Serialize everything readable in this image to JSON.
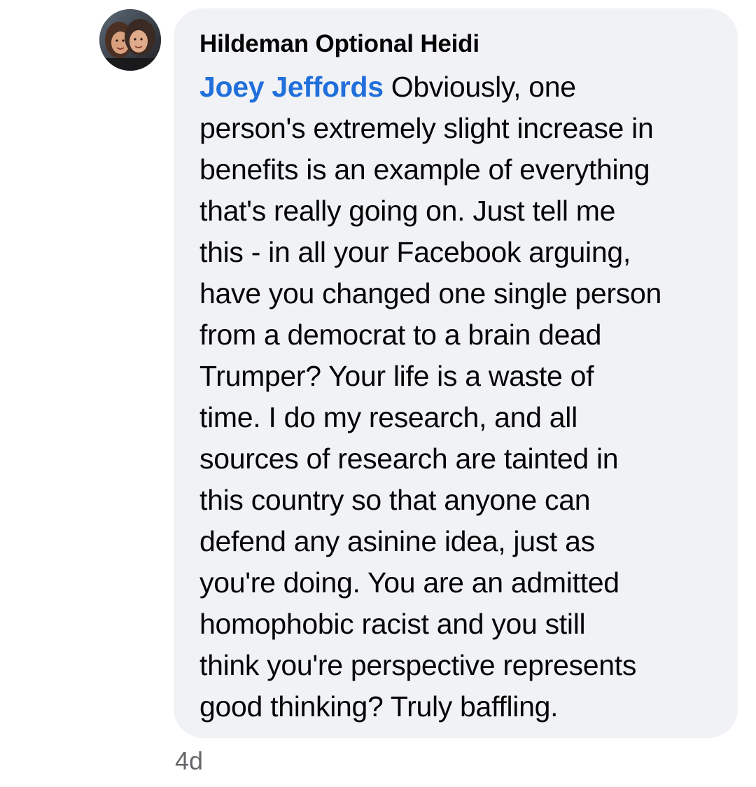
{
  "comment": {
    "author": "Hildeman Optional Heidi",
    "mention": "Joey Jeffords",
    "lines": [
      " Obviously, one",
      "person's extremely slight increase in",
      "benefits is an example of everything",
      "that's really going on. Just tell me",
      "this - in all your Facebook arguing,",
      "have you changed one single person",
      "from a democrat to a brain dead",
      "Trumper? Your life is a waste of",
      "time. I do my research, and all",
      "sources of research are tainted in",
      "this country so that anyone can",
      "defend any asinine idea, just as",
      "you're doing. You are an admitted",
      "homophobic racist and you still",
      "think you're perspective represents",
      "good thinking? Truly baffling."
    ],
    "timestamp": "4d",
    "avatar_icon": "profile-photo"
  },
  "colors": {
    "bubble_background": "#f0f2f5",
    "mention": "#216fdb",
    "timestamp": "#65676b",
    "text": "#050505"
  }
}
